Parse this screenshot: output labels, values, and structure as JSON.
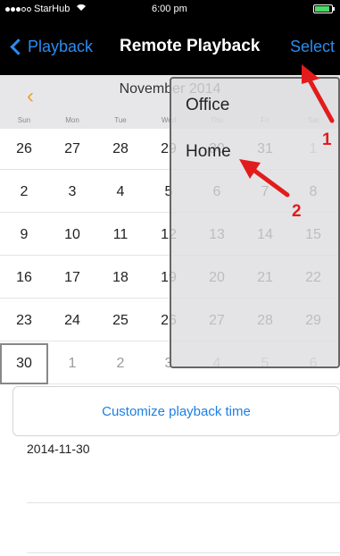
{
  "status_bar": {
    "carrier": "StarHub",
    "time": "6:00 pm",
    "battery_level": 0.9,
    "wifi_icon": "wifi-icon"
  },
  "nav": {
    "back_label": "Playback",
    "title": "Remote Playback",
    "select_label": "Select",
    "back_icon": "chevron-left-icon"
  },
  "calendar": {
    "month": "November 2014",
    "prev_icon": "chevron-left-icon",
    "weekdays": [
      "Sun",
      "Mon",
      "Tue",
      "Wed",
      "Thu",
      "Fri",
      "Sat"
    ],
    "weeks": [
      [
        "26",
        "27",
        "28",
        "29",
        "30",
        "31",
        "1"
      ],
      [
        "2",
        "3",
        "4",
        "5",
        "6",
        "7",
        "8"
      ],
      [
        "9",
        "10",
        "11",
        "12",
        "13",
        "14",
        "15"
      ],
      [
        "16",
        "17",
        "18",
        "19",
        "20",
        "21",
        "22"
      ],
      [
        "23",
        "24",
        "25",
        "26",
        "27",
        "28",
        "29"
      ],
      [
        "30",
        "1",
        "2",
        "3",
        "4",
        "5",
        "6"
      ]
    ],
    "selected_day": "30"
  },
  "dropdown": {
    "items": [
      "Office",
      "Home"
    ]
  },
  "customize_label": "Customize playback time",
  "selected_date": "2014-11-30",
  "annotations": {
    "label_1": "1",
    "label_2": "2",
    "color": "#e21c1c"
  },
  "colors": {
    "accent": "#2a8cf0",
    "prev_arrow": "#f0a030",
    "nav_background": "#000000"
  }
}
